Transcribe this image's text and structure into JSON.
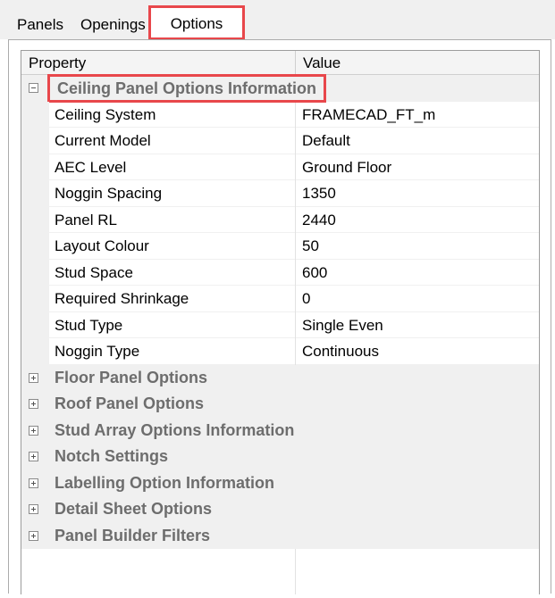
{
  "tabs": [
    {
      "label": "Panels"
    },
    {
      "label": "Openings"
    },
    {
      "label": "Options"
    }
  ],
  "grid": {
    "header": {
      "property": "Property",
      "value": "Value"
    },
    "expanded_category": {
      "title": "Ceiling Panel Options Information",
      "rows": [
        {
          "name": "Ceiling System",
          "value": "FRAMECAD_FT_m"
        },
        {
          "name": "Current Model",
          "value": "Default"
        },
        {
          "name": "AEC Level",
          "value": "Ground Floor"
        },
        {
          "name": "Noggin Spacing",
          "value": "1350"
        },
        {
          "name": "Panel RL",
          "value": "2440"
        },
        {
          "name": "Layout Colour",
          "value": "50"
        },
        {
          "name": "Stud Space",
          "value": "600"
        },
        {
          "name": "Required Shrinkage",
          "value": "0"
        },
        {
          "name": "Stud Type",
          "value": "Single Even"
        },
        {
          "name": "Noggin Type",
          "value": "Continuous"
        }
      ]
    },
    "collapsed_categories": [
      {
        "title": "Floor Panel Options"
      },
      {
        "title": "Roof Panel Options"
      },
      {
        "title": "Stud Array Options Information"
      },
      {
        "title": "Notch Settings"
      },
      {
        "title": "Labelling Option Information"
      },
      {
        "title": "Detail Sheet Options"
      },
      {
        "title": "Panel Builder Filters"
      }
    ]
  },
  "colors": {
    "highlight_box": "#e8474b",
    "category_background": "#f0f0f0",
    "category_text": "#6d6d6d"
  },
  "icons": {
    "expanded": "collapse-minus-icon",
    "collapsed": "expand-plus-icon"
  }
}
